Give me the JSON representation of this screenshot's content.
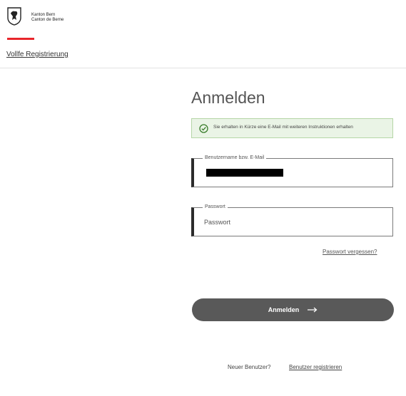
{
  "header": {
    "org_line_1": "Kanton Bern",
    "org_line_2": "Canton de Berne",
    "nav_link": "Vollfe Registrierung"
  },
  "main": {
    "title": "Anmelden",
    "alert": {
      "message": "Sie erhalten in Kürze eine E-Mail mit weiteren Instruktionen erhalten",
      "icon": "check-circle-icon",
      "border_color": "#b5d6a6",
      "background_color": "#eaf4e6"
    },
    "username_field": {
      "label": "Benutzername bzw. E-Mail",
      "value": ""
    },
    "password_field": {
      "label": "Passwort",
      "placeholder": "Passwort"
    },
    "forgot_password_link": "Passwort vergessen?",
    "login_button": {
      "label": "Anmelden",
      "icon": "arrow-right-icon",
      "color": "#595959"
    },
    "footer": {
      "question": "Neuer Benutzer?",
      "register_link": "Benutzer registrieren"
    }
  },
  "colors": {
    "accent_red": "#e8262b"
  }
}
